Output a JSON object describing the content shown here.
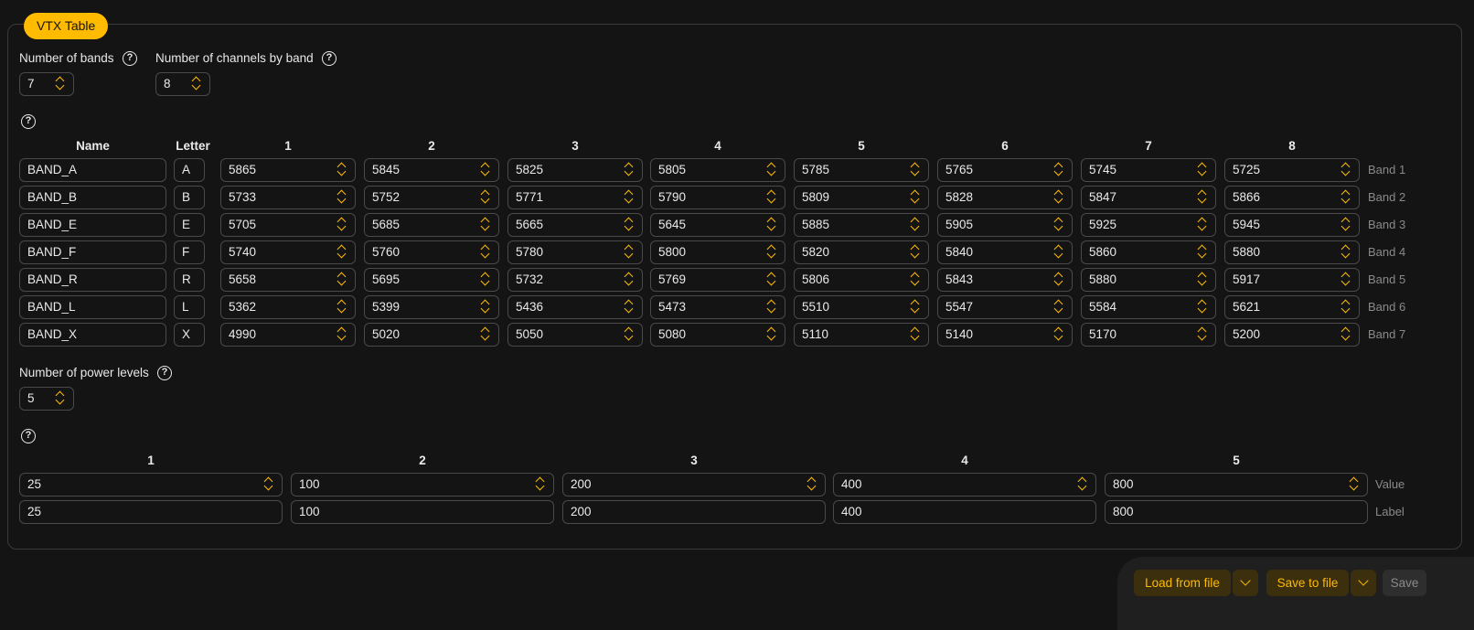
{
  "section_title": "VTX Table",
  "num_bands": {
    "label": "Number of bands",
    "value": "7"
  },
  "num_channels": {
    "label": "Number of channels by band",
    "value": "8"
  },
  "bands_table": {
    "headers": {
      "name": "Name",
      "letter": "Letter",
      "channels": [
        "1",
        "2",
        "3",
        "4",
        "5",
        "6",
        "7",
        "8"
      ]
    },
    "rows": [
      {
        "name": "BAND_A",
        "letter": "A",
        "freqs": [
          "5865",
          "5845",
          "5825",
          "5805",
          "5785",
          "5765",
          "5745",
          "5725"
        ],
        "tag": "Band 1"
      },
      {
        "name": "BAND_B",
        "letter": "B",
        "freqs": [
          "5733",
          "5752",
          "5771",
          "5790",
          "5809",
          "5828",
          "5847",
          "5866"
        ],
        "tag": "Band 2"
      },
      {
        "name": "BAND_E",
        "letter": "E",
        "freqs": [
          "5705",
          "5685",
          "5665",
          "5645",
          "5885",
          "5905",
          "5925",
          "5945"
        ],
        "tag": "Band 3"
      },
      {
        "name": "BAND_F",
        "letter": "F",
        "freqs": [
          "5740",
          "5760",
          "5780",
          "5800",
          "5820",
          "5840",
          "5860",
          "5880"
        ],
        "tag": "Band 4"
      },
      {
        "name": "BAND_R",
        "letter": "R",
        "freqs": [
          "5658",
          "5695",
          "5732",
          "5769",
          "5806",
          "5843",
          "5880",
          "5917"
        ],
        "tag": "Band 5"
      },
      {
        "name": "BAND_L",
        "letter": "L",
        "freqs": [
          "5362",
          "5399",
          "5436",
          "5473",
          "5510",
          "5547",
          "5584",
          "5621"
        ],
        "tag": "Band 6"
      },
      {
        "name": "BAND_X",
        "letter": "X",
        "freqs": [
          "4990",
          "5020",
          "5050",
          "5080",
          "5110",
          "5140",
          "5170",
          "5200"
        ],
        "tag": "Band 7"
      }
    ]
  },
  "num_power": {
    "label": "Number of power levels",
    "value": "5"
  },
  "power_table": {
    "headers": [
      "1",
      "2",
      "3",
      "4",
      "5"
    ],
    "values": [
      "25",
      "100",
      "200",
      "400",
      "800"
    ],
    "labels": [
      "25",
      "100",
      "200",
      "400",
      "800"
    ],
    "value_tag": "Value",
    "label_tag": "Label"
  },
  "help_glyph": "?",
  "footer": {
    "load_label": "Load from file",
    "save_file_label": "Save to file",
    "save_label": "Save"
  },
  "colors": {
    "accent": "#ffbb00",
    "background": "#141414",
    "border": "#4a4a4a"
  }
}
